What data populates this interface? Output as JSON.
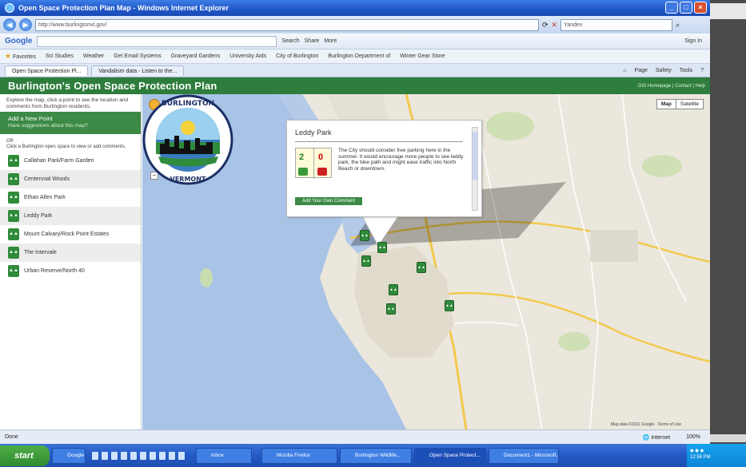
{
  "window": {
    "title": "Open Space Protection Plan Map - Windows Internet Explorer",
    "controls": [
      "_",
      "□",
      "×"
    ]
  },
  "addressbar": {
    "url": "http://www.burlingtonvt.gov/",
    "search_placeholder": "Yandex"
  },
  "googlebar": {
    "logo": "Google",
    "search_label": "Search",
    "share_label": "Share",
    "more_label": "More",
    "signin_label": "Sign In"
  },
  "favbar": {
    "favorites_label": "Favorites",
    "items": [
      "Sci Studies",
      "Weather",
      "Get Email Systems",
      "Graveyard Gardens",
      "University Aids",
      "City of Burlington",
      "Burlington Department of",
      "Winter Gear Store"
    ]
  },
  "tabs": [
    {
      "label": "Open Space Protection Pl..."
    },
    {
      "label": "Vandalism data - Listen to the..."
    }
  ],
  "cmdbar": {
    "page_label": "Page",
    "safety_label": "Safety",
    "tools_label": "Tools"
  },
  "app": {
    "title": "Burlington's Open Space Protection Plan",
    "header_right": "GIS Homepage | Contact | Help"
  },
  "sidebar": {
    "intro": "Explore the map, click a point to see the location and comments from Burlington residents.",
    "add_title": "Add a New Point",
    "add_sub": "Have suggestions about this map?",
    "note_label": "OR",
    "note": "Click a Burlington open space to view or add comments.",
    "locations": [
      {
        "label": "Callahan Park/Farm Garden"
      },
      {
        "label": "Centennial Woods"
      },
      {
        "label": "Ethan Allen Park"
      },
      {
        "label": "Leddy Park"
      },
      {
        "label": "Mount Calvary/Rock Point Estates"
      },
      {
        "label": "The Intervale"
      },
      {
        "label": "Urban Reserve/North 40"
      }
    ]
  },
  "map": {
    "type_buttons": [
      "Map",
      "Satellite"
    ],
    "footer": "Map data ©2011 Google - Terms of Use"
  },
  "infowindow": {
    "title": "Leddy Park",
    "votes_up": "2",
    "votes_down": "0",
    "comment": "The City should consider free parking here in the summer. It would encourage more people to see leddy park, the bike path and might ease traffic into North Beach or downtown.",
    "add_button": "Add Your Own Comment"
  },
  "logo": {
    "text_top": "BURLINGTON",
    "text_bottom": "VERMONT"
  },
  "statusbar": {
    "left": "Done",
    "zone": "Internet",
    "zoom": "100%"
  },
  "taskbar": {
    "start": "start",
    "items": [
      "Google",
      "Inbox",
      "Mozilla Firefox",
      "Burlington Wildlife...",
      "Open Space Protect...",
      "Document1 - Microsoft..."
    ],
    "clock": "12:58 PM"
  },
  "colors": {
    "brand_green": "#2e7d3c",
    "water": "#a9c3e6",
    "land": "#ebe7dd"
  }
}
